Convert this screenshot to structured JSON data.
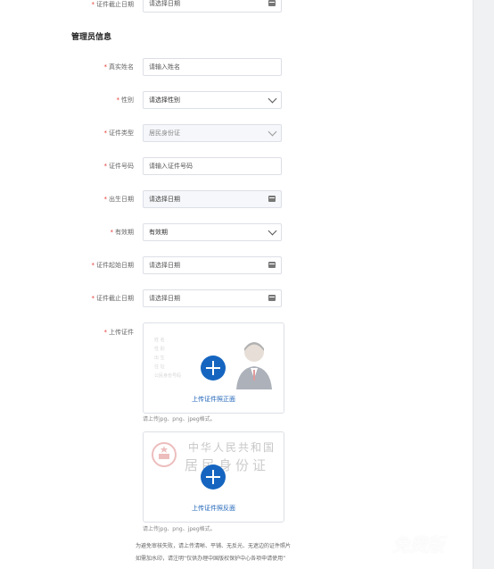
{
  "form": {
    "top_end_date": {
      "label": "证件截止日期",
      "placeholder": "请选择日期"
    },
    "section_title": "管理员信息",
    "fields": [
      {
        "label": "真实姓名",
        "placeholder": "请输入姓名"
      },
      {
        "label": "性别",
        "placeholder": "请选择性别"
      },
      {
        "label": "证件类型",
        "value": "居民身份证"
      },
      {
        "label": "证件号码",
        "placeholder": "请输入证件号码"
      },
      {
        "label": "出生日期",
        "placeholder": "请选择日期"
      },
      {
        "label": "有效期",
        "value": "有效期"
      },
      {
        "label": "证件起始日期",
        "placeholder": "请选择日期"
      },
      {
        "label": "证件截止日期",
        "placeholder": "请选择日期"
      }
    ],
    "upload": {
      "label": "上传证件",
      "front_text": "上传证件照正面",
      "front_hint": "请上传jpg、png、jpeg格式。",
      "back_text": "上传证件照反面",
      "back_hint": "请上传jpg、png、jpeg格式。",
      "card_front_lines": [
        "姓 名",
        "性 别",
        "出 生",
        "住 址",
        "公民身份号码"
      ],
      "card_back_title": "中华人民共和国",
      "card_back_subtitle": "居民身份证"
    },
    "note_lines": [
      "为避免审核失败，请上传清晰、平铺、无反光、无遮边的证件照片",
      "如需加水印，请注明“仅供办理中国版权保护中心各项申请使用”"
    ]
  },
  "watermark": "免费版",
  "colors": {
    "accent": "#1565c0",
    "required": "#e53935",
    "link": "#1e63b8"
  }
}
